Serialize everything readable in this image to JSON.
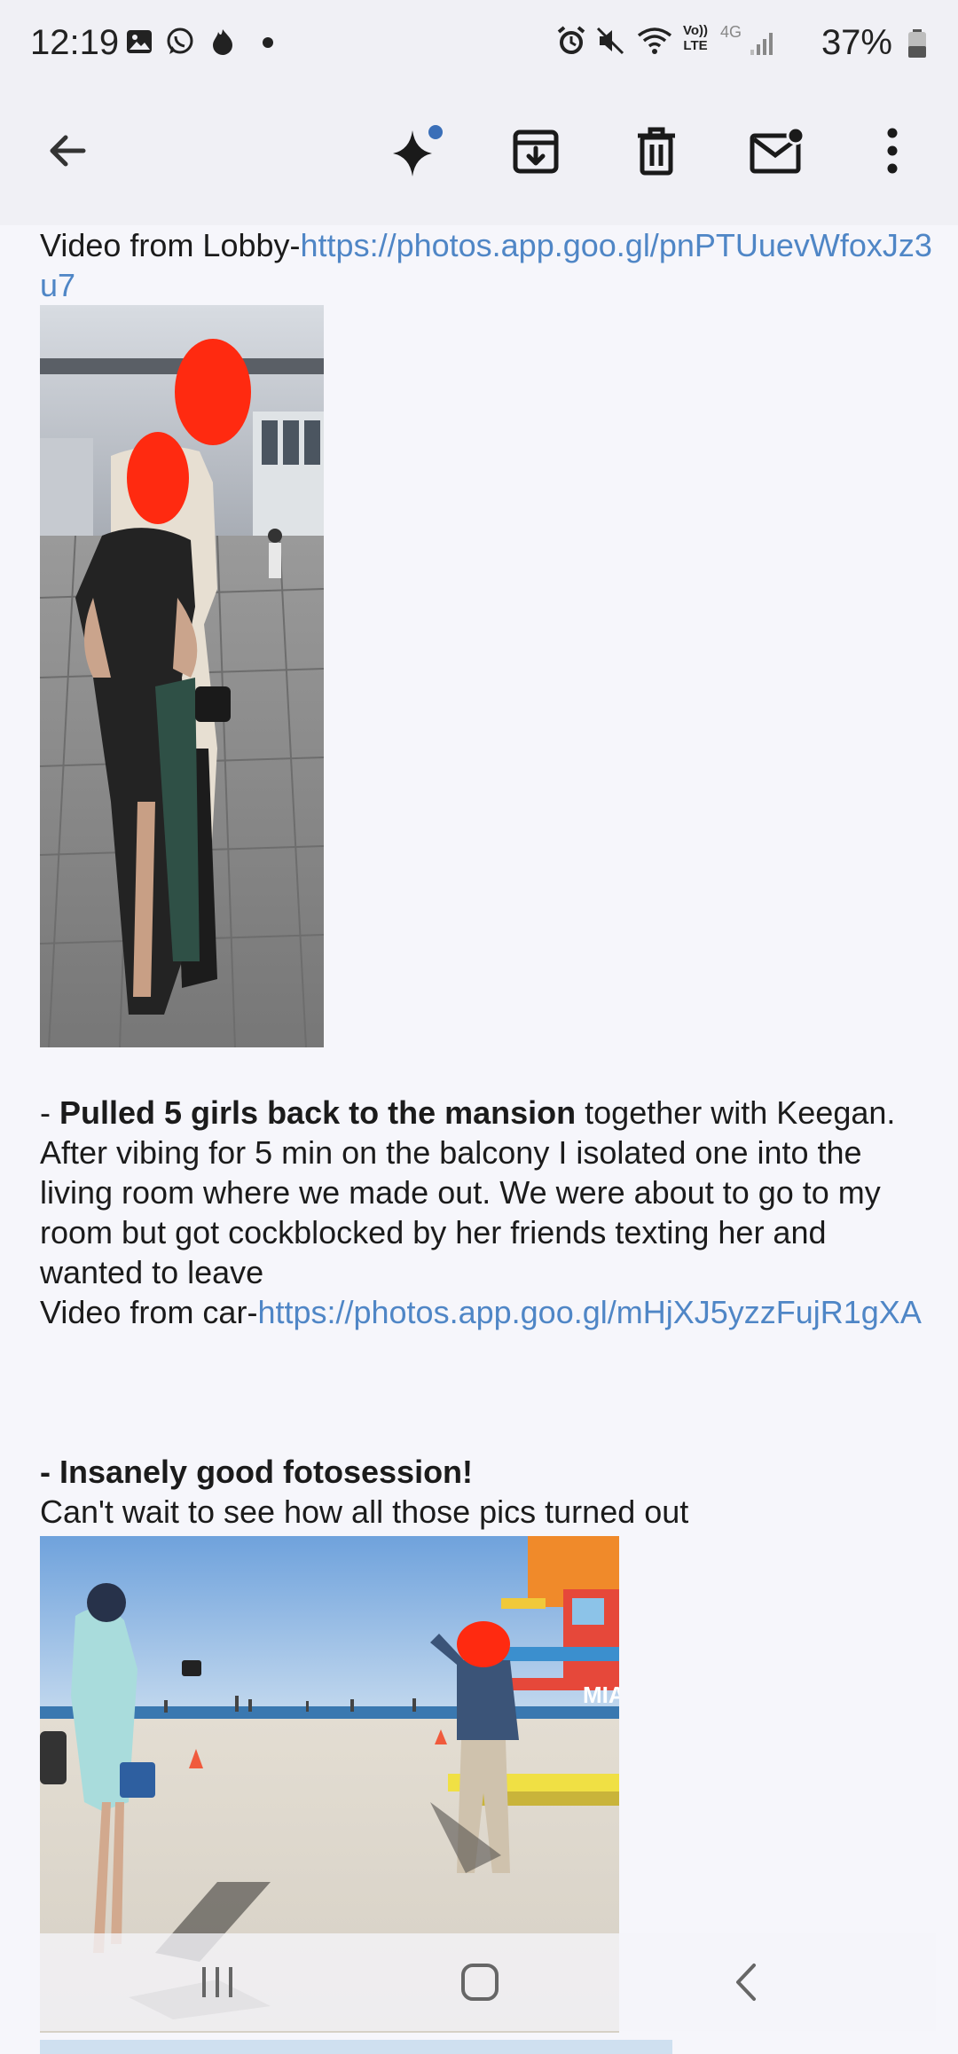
{
  "status_bar": {
    "time": "12:19",
    "battery": "37%",
    "network": "4G",
    "volte": "Vo)) LTE"
  },
  "toolbar": {
    "back": "arrow-left-icon",
    "gemini": "sparkle-icon",
    "archive": "archive-icon",
    "delete": "trash-icon",
    "mark_unread": "mail-unread-icon",
    "more": "more-vert-icon"
  },
  "email": {
    "line1_prefix": "Video from Lobby-",
    "line1_link": "https://photos.app.goo.gl/pnPTUuevWfoxJz3u7",
    "para2_dash": "- ",
    "para2_bold": "Pulled 5 girls back to the mansion",
    "para2_text": " together with Keegan. After vibing for 5 min on the balcony I isolated one into the living room where we made out. We were about to go to my room but got cockblocked by her friends texting her and wanted to leave",
    "line_car_prefix": "Video from car-",
    "line_car_link": "https://photos.app.goo.gl/mHjXJ5yzzFujR1gXA",
    "para3_bold": "- Insanely good fotosession!",
    "para3_text": "Can't wait to see how all those pics turned out",
    "photo2_sign_text": "MIA"
  },
  "colors": {
    "link": "#4f86c6",
    "redaction": "#ff2a10",
    "background": "#f6f6fb",
    "toolbar_bg": "#f0f0f5"
  },
  "nav": {
    "recents": "recents-icon",
    "home": "home-icon",
    "back": "back-chevron-icon"
  }
}
